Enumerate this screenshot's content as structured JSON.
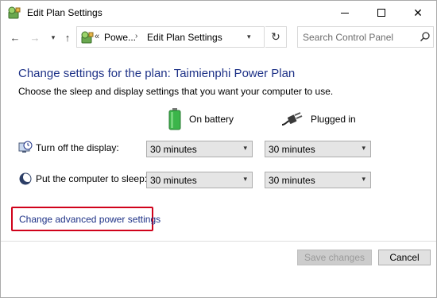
{
  "window": {
    "title": "Edit Plan Settings",
    "controls": {
      "minimize": "minimize",
      "maximize": "maximize",
      "close": "close"
    }
  },
  "nav": {
    "breadcrumb_overflow": "«",
    "crumb1": "Powe...",
    "crumb_sep": "›",
    "crumb2": "Edit Plan Settings",
    "search_placeholder": "Search Control Panel"
  },
  "main": {
    "heading": "Change settings for the plan: Taimienphi Power Plan",
    "description": "Choose the sleep and display settings that you want your computer to use.",
    "columns": {
      "battery": "On battery",
      "plugged": "Plugged in"
    },
    "rows": [
      {
        "label": "Turn off the display:",
        "battery_value": "30 minutes",
        "plugged_value": "30 minutes"
      },
      {
        "label": "Put the computer to sleep:",
        "battery_value": "30 minutes",
        "plugged_value": "30 minutes"
      }
    ],
    "advanced_link": "Change advanced power settings"
  },
  "footer": {
    "save_label": "Save changes",
    "cancel_label": "Cancel"
  },
  "colors": {
    "heading": "#1e3287",
    "highlight_box": "#d0021b",
    "battery_green": "#3bb54a"
  }
}
